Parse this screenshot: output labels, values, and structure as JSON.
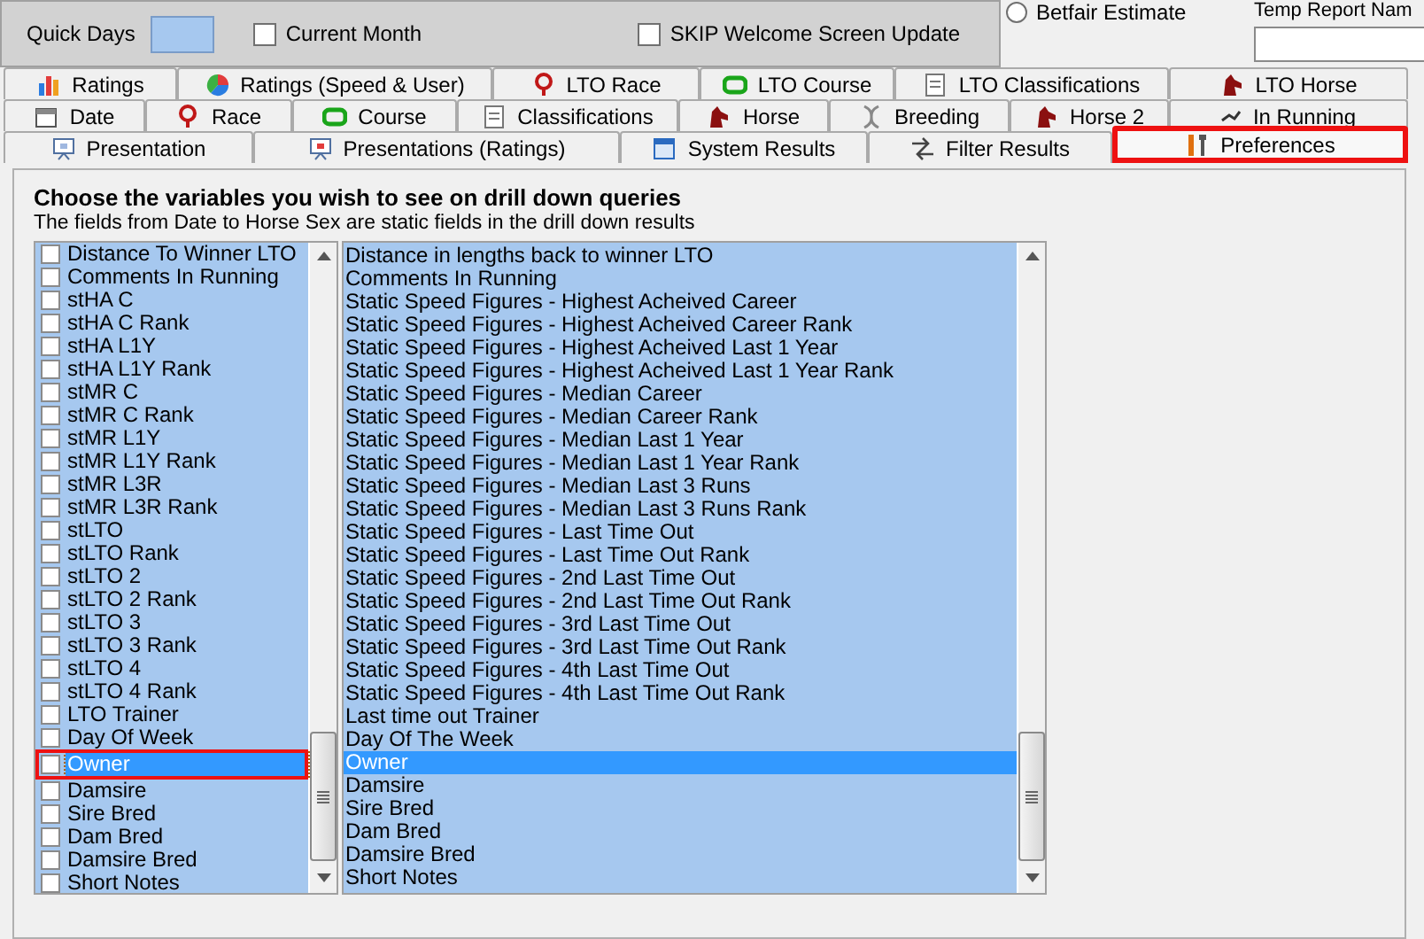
{
  "top": {
    "quick_days_label": "Quick Days",
    "current_month": {
      "label": "Current Month",
      "checked": false
    },
    "skip_welcome": {
      "label": "SKIP Welcome Screen Update",
      "checked": false
    },
    "betfair_estimate": {
      "label": "Betfair Estimate",
      "selected": false
    },
    "temp_report_name_label": "Temp Report Nam"
  },
  "tab_rows": [
    [
      {
        "label": "Ratings",
        "selected": false,
        "highlighted": false
      },
      {
        "label": "Ratings (Speed & User)",
        "selected": false,
        "highlighted": false
      },
      {
        "label": "LTO Race",
        "selected": false,
        "highlighted": false
      },
      {
        "label": "LTO Course",
        "selected": false,
        "highlighted": false
      },
      {
        "label": "LTO Classifications",
        "selected": false,
        "highlighted": false
      },
      {
        "label": "LTO Horse",
        "selected": false,
        "highlighted": false
      }
    ],
    [
      {
        "label": "Date",
        "selected": false,
        "highlighted": false
      },
      {
        "label": "Race",
        "selected": false,
        "highlighted": false
      },
      {
        "label": "Course",
        "selected": false,
        "highlighted": false
      },
      {
        "label": "Classifications",
        "selected": false,
        "highlighted": false
      },
      {
        "label": "Horse",
        "selected": false,
        "highlighted": false
      },
      {
        "label": "Breeding",
        "selected": false,
        "highlighted": false
      },
      {
        "label": "Horse 2",
        "selected": false,
        "highlighted": false
      },
      {
        "label": "In Running",
        "selected": false,
        "highlighted": false
      }
    ],
    [
      {
        "label": "Presentation",
        "selected": false,
        "highlighted": false
      },
      {
        "label": "Presentations (Ratings)",
        "selected": false,
        "highlighted": false
      },
      {
        "label": "System Results",
        "selected": false,
        "highlighted": false
      },
      {
        "label": "Filter Results",
        "selected": false,
        "highlighted": false
      },
      {
        "label": "Preferences",
        "selected": true,
        "highlighted": true
      }
    ]
  ],
  "heading": "Choose the variables you wish to see on drill down queries",
  "subheading": "The fields from Date to Horse Sex are static fields in the drill down results",
  "variables": [
    {
      "label": "Distance To Winner LTO",
      "checked": false,
      "selected": false,
      "highlighted": false
    },
    {
      "label": "Comments In Running",
      "checked": false,
      "selected": false,
      "highlighted": false
    },
    {
      "label": "stHA C",
      "checked": false,
      "selected": false,
      "highlighted": false
    },
    {
      "label": "stHA C Rank",
      "checked": false,
      "selected": false,
      "highlighted": false
    },
    {
      "label": "stHA L1Y",
      "checked": false,
      "selected": false,
      "highlighted": false
    },
    {
      "label": "stHA L1Y Rank",
      "checked": false,
      "selected": false,
      "highlighted": false
    },
    {
      "label": "stMR C",
      "checked": false,
      "selected": false,
      "highlighted": false
    },
    {
      "label": "stMR C Rank",
      "checked": false,
      "selected": false,
      "highlighted": false
    },
    {
      "label": "stMR L1Y",
      "checked": false,
      "selected": false,
      "highlighted": false
    },
    {
      "label": "stMR L1Y Rank",
      "checked": false,
      "selected": false,
      "highlighted": false
    },
    {
      "label": "stMR L3R",
      "checked": false,
      "selected": false,
      "highlighted": false
    },
    {
      "label": "stMR L3R Rank",
      "checked": false,
      "selected": false,
      "highlighted": false
    },
    {
      "label": "stLTO",
      "checked": false,
      "selected": false,
      "highlighted": false
    },
    {
      "label": "stLTO Rank",
      "checked": false,
      "selected": false,
      "highlighted": false
    },
    {
      "label": "stLTO 2",
      "checked": false,
      "selected": false,
      "highlighted": false
    },
    {
      "label": "stLTO 2 Rank",
      "checked": false,
      "selected": false,
      "highlighted": false
    },
    {
      "label": "stLTO 3",
      "checked": false,
      "selected": false,
      "highlighted": false
    },
    {
      "label": "stLTO 3 Rank",
      "checked": false,
      "selected": false,
      "highlighted": false
    },
    {
      "label": "stLTO 4",
      "checked": false,
      "selected": false,
      "highlighted": false
    },
    {
      "label": "stLTO 4 Rank",
      "checked": false,
      "selected": false,
      "highlighted": false
    },
    {
      "label": "LTO Trainer",
      "checked": false,
      "selected": false,
      "highlighted": false
    },
    {
      "label": "Day Of Week",
      "checked": false,
      "selected": false,
      "highlighted": false
    },
    {
      "label": "Owner",
      "checked": false,
      "selected": true,
      "highlighted": true
    },
    {
      "label": "Damsire",
      "checked": false,
      "selected": false,
      "highlighted": false
    },
    {
      "label": "Sire Bred",
      "checked": false,
      "selected": false,
      "highlighted": false
    },
    {
      "label": "Dam Bred",
      "checked": false,
      "selected": false,
      "highlighted": false
    },
    {
      "label": "Damsire Bred",
      "checked": false,
      "selected": false,
      "highlighted": false
    },
    {
      "label": "Short Notes",
      "checked": false,
      "selected": false,
      "highlighted": false
    }
  ],
  "descriptions": [
    {
      "text": "Distance in lengths back to winner LTO",
      "selected": false
    },
    {
      "text": "Comments In Running",
      "selected": false
    },
    {
      "text": "Static Speed Figures - Highest Acheived Career",
      "selected": false
    },
    {
      "text": "Static Speed Figures - Highest Acheived Career Rank",
      "selected": false
    },
    {
      "text": "Static Speed Figures - Highest Acheived Last 1 Year",
      "selected": false
    },
    {
      "text": "Static Speed Figures - Highest Acheived Last 1 Year Rank",
      "selected": false
    },
    {
      "text": "Static Speed Figures - Median Career",
      "selected": false
    },
    {
      "text": "Static Speed Figures - Median Career Rank",
      "selected": false
    },
    {
      "text": "Static Speed Figures - Median Last 1 Year",
      "selected": false
    },
    {
      "text": "Static Speed Figures - Median Last 1 Year Rank",
      "selected": false
    },
    {
      "text": "Static Speed Figures - Median Last 3 Runs",
      "selected": false
    },
    {
      "text": "Static Speed Figures - Median Last 3 Runs Rank",
      "selected": false
    },
    {
      "text": "Static Speed Figures - Last Time Out",
      "selected": false
    },
    {
      "text": "Static Speed Figures - Last Time Out Rank",
      "selected": false
    },
    {
      "text": "Static Speed Figures - 2nd Last Time Out",
      "selected": false
    },
    {
      "text": "Static Speed Figures - 2nd Last Time Out Rank",
      "selected": false
    },
    {
      "text": "Static Speed Figures - 3rd Last Time Out",
      "selected": false
    },
    {
      "text": "Static Speed Figures - 3rd Last Time Out Rank",
      "selected": false
    },
    {
      "text": "Static Speed Figures - 4th Last Time Out",
      "selected": false
    },
    {
      "text": "Static Speed Figures - 4th Last Time Out Rank",
      "selected": false
    },
    {
      "text": "Last time out Trainer",
      "selected": false
    },
    {
      "text": "Day Of The Week",
      "selected": false
    },
    {
      "text": "Owner",
      "selected": true
    },
    {
      "text": "Damsire",
      "selected": false
    },
    {
      "text": "Sire Bred",
      "selected": false
    },
    {
      "text": "Dam Bred",
      "selected": false
    },
    {
      "text": "Damsire Bred",
      "selected": false
    },
    {
      "text": "Short Notes",
      "selected": false
    }
  ]
}
